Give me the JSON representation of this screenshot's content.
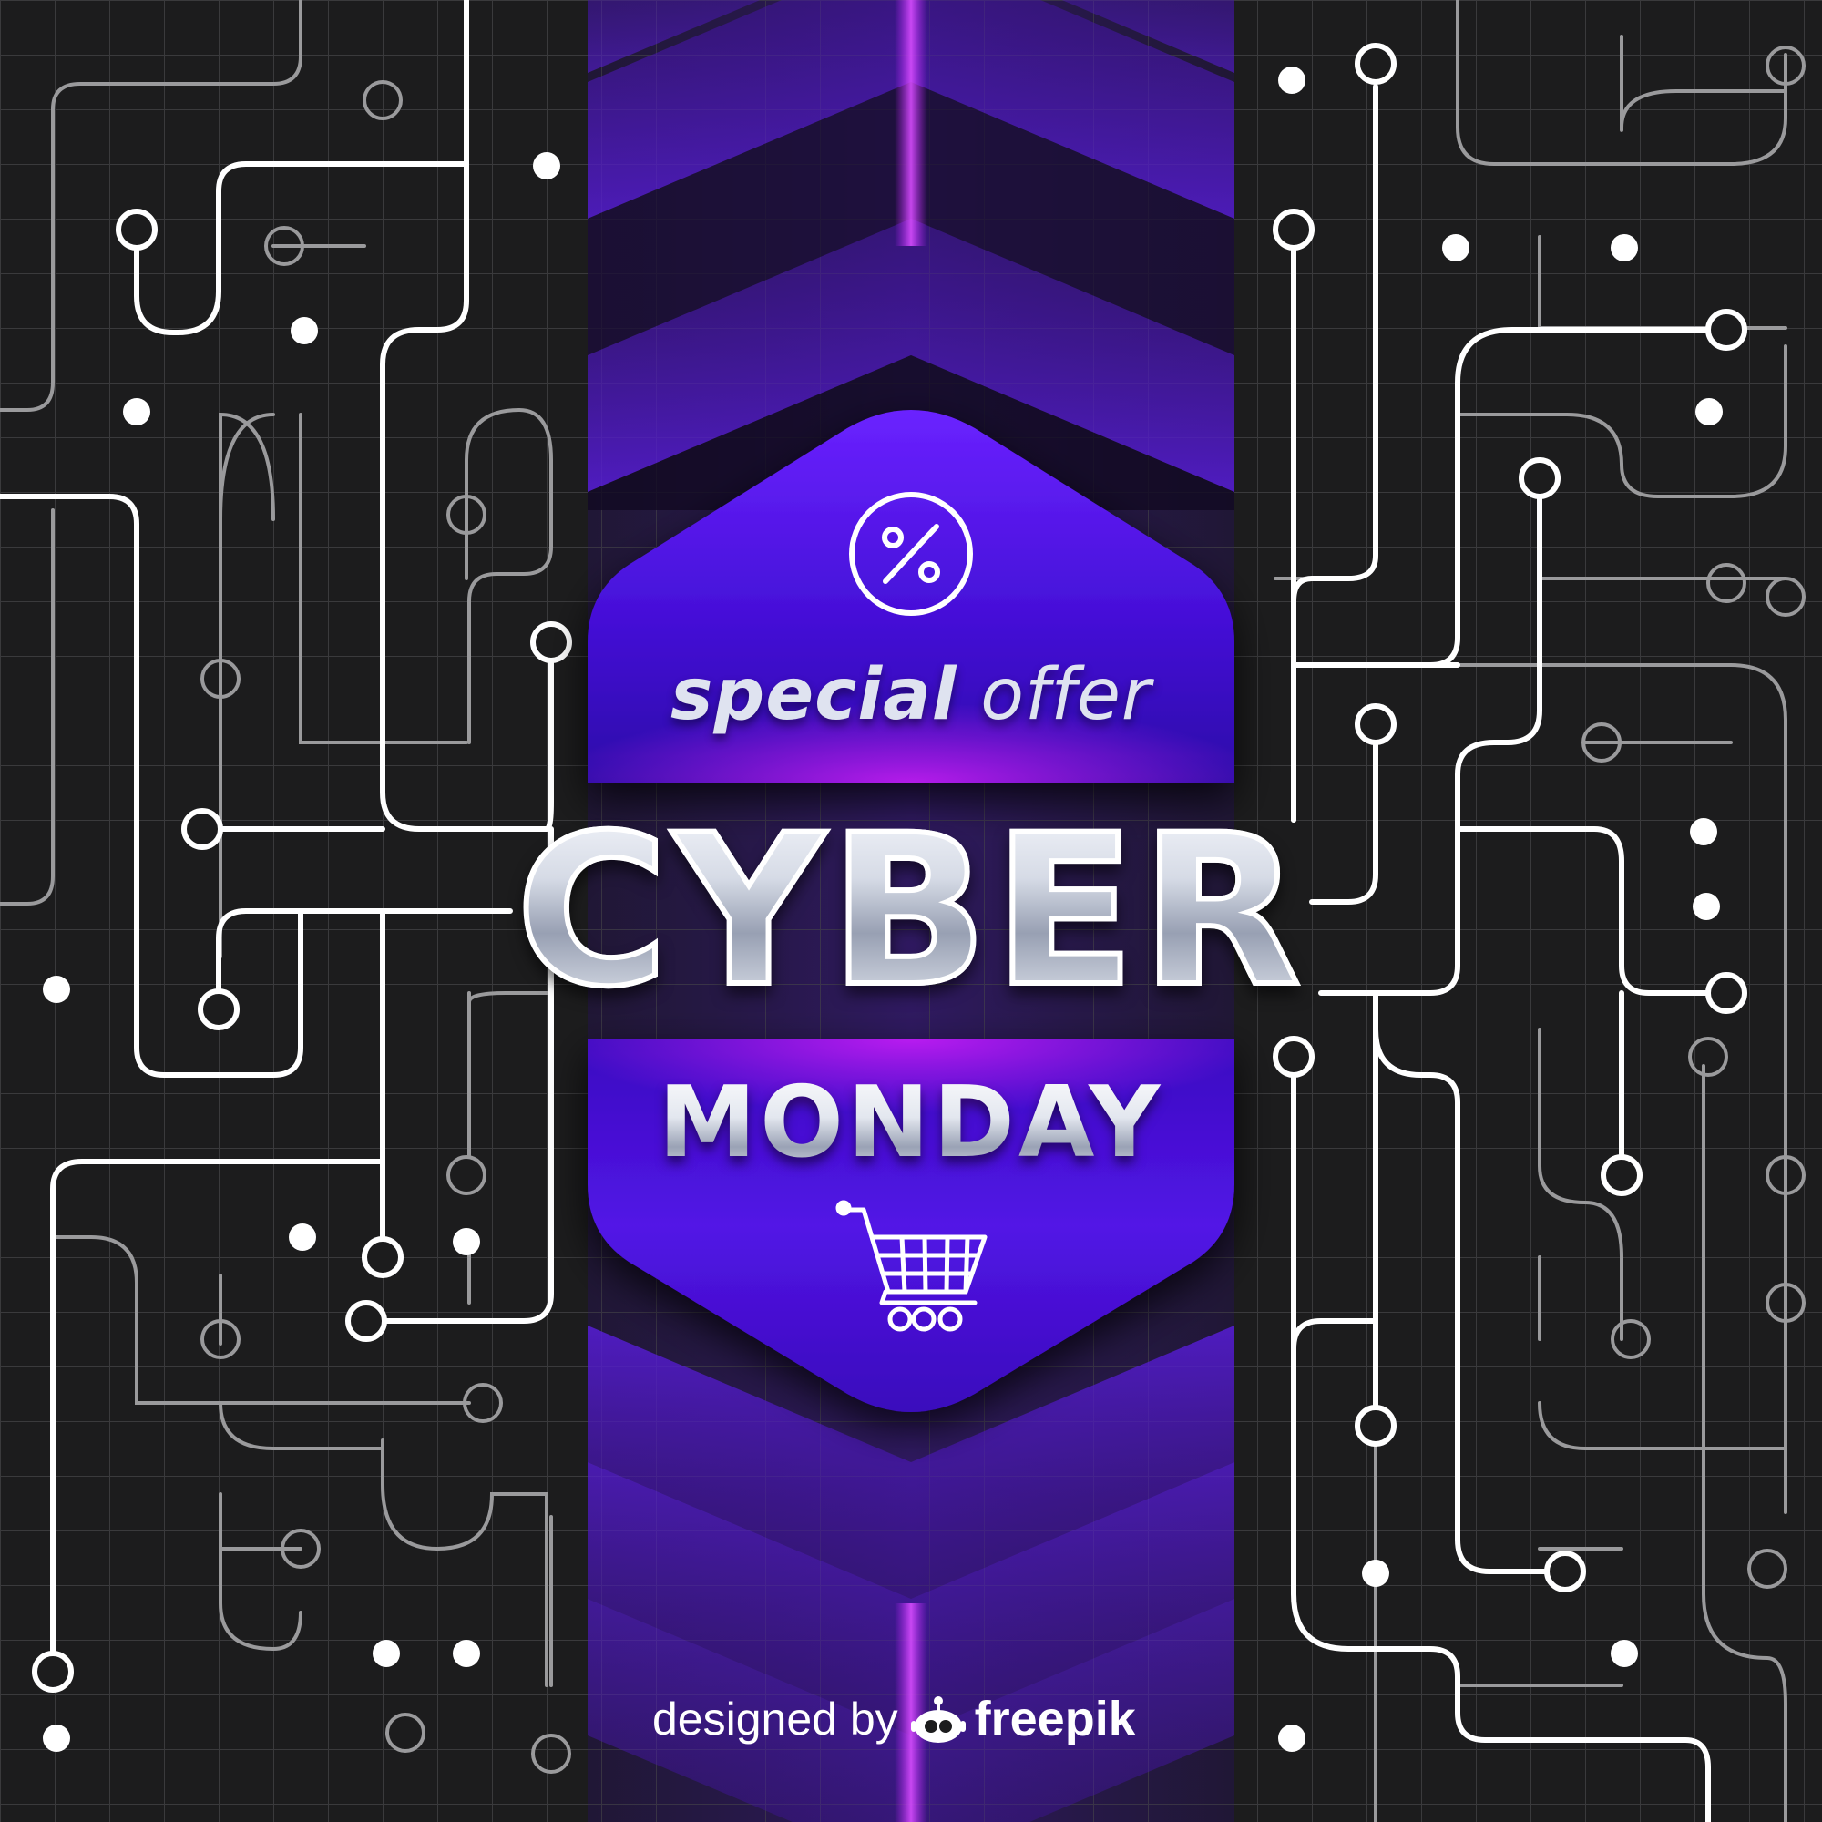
{
  "poster": {
    "tagline_part1": "special",
    "tagline_part2": "offer",
    "headline": "CYBER",
    "subheadline": "MONDAY"
  },
  "credit": {
    "prefix": "designed by",
    "brand": "freepik"
  },
  "icons": {
    "badge": "percent-icon",
    "cart": "shopping-cart-icon",
    "brand_logo": "freepik-mascot-icon"
  },
  "colors": {
    "background": "#1c1c1d",
    "grid_line": "#3a3a3c",
    "circuit_bright": "#ffffff",
    "circuit_dim": "#9a9a9c",
    "purple_dark": "#3a10b8",
    "purple_light": "#6a22ff",
    "magenta_glow": "#d21cff",
    "text_silver": "#d8dde8"
  }
}
